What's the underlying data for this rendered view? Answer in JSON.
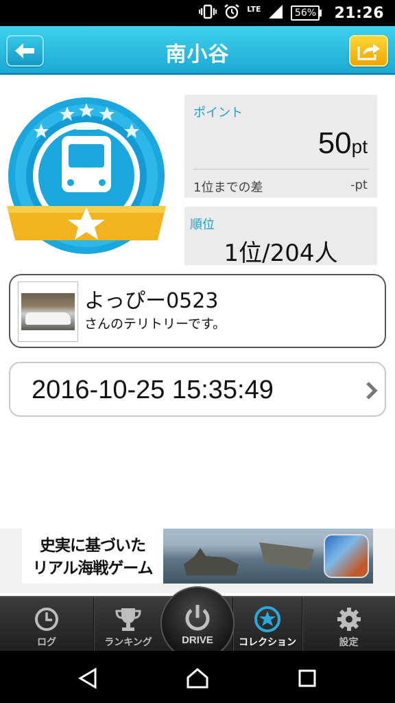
{
  "status_bar": {
    "network": "LTE",
    "battery": "56%",
    "battery_level": 0.56,
    "time": "21:26",
    "icons": [
      "vibrate-icon",
      "alarm-icon",
      "signal-icon",
      "battery-icon"
    ]
  },
  "header": {
    "title": "南小谷",
    "back_icon": "arrow-left-icon",
    "share_icon": "share-icon",
    "colors": {
      "bar": "#1ba9d3",
      "share": "#f1a500"
    }
  },
  "badge": {
    "icon": "train-badge-icon",
    "stars": 5,
    "colors": {
      "ring": "#1aa7de",
      "ribbon": "#f2b320"
    }
  },
  "points": {
    "label": "ポイント",
    "value": "50",
    "unit": "pt",
    "gap_label": "1位までの差",
    "gap_value": "-pt"
  },
  "rank": {
    "label": "順位",
    "value": "1位/204人"
  },
  "owner": {
    "name": "よっぴー0523",
    "subtitle": "さんのテリトリーです。"
  },
  "date": {
    "value": "2016-10-25 15:35:49"
  },
  "ad": {
    "line1": "史実に基づいた",
    "line2": "リアル海戦ゲーム"
  },
  "tabs": [
    {
      "label": "ログ",
      "icon": "clock-icon"
    },
    {
      "label": "ランキング",
      "icon": "trophy-icon"
    },
    {
      "label": "DRIVE",
      "icon": "power-icon"
    },
    {
      "label": "コレクション",
      "icon": "star-circle-icon",
      "active": true
    },
    {
      "label": "設定",
      "icon": "gear-icon"
    }
  ],
  "nav": {
    "back": "nav-back-icon",
    "home": "nav-home-icon",
    "recents": "nav-recents-icon"
  }
}
